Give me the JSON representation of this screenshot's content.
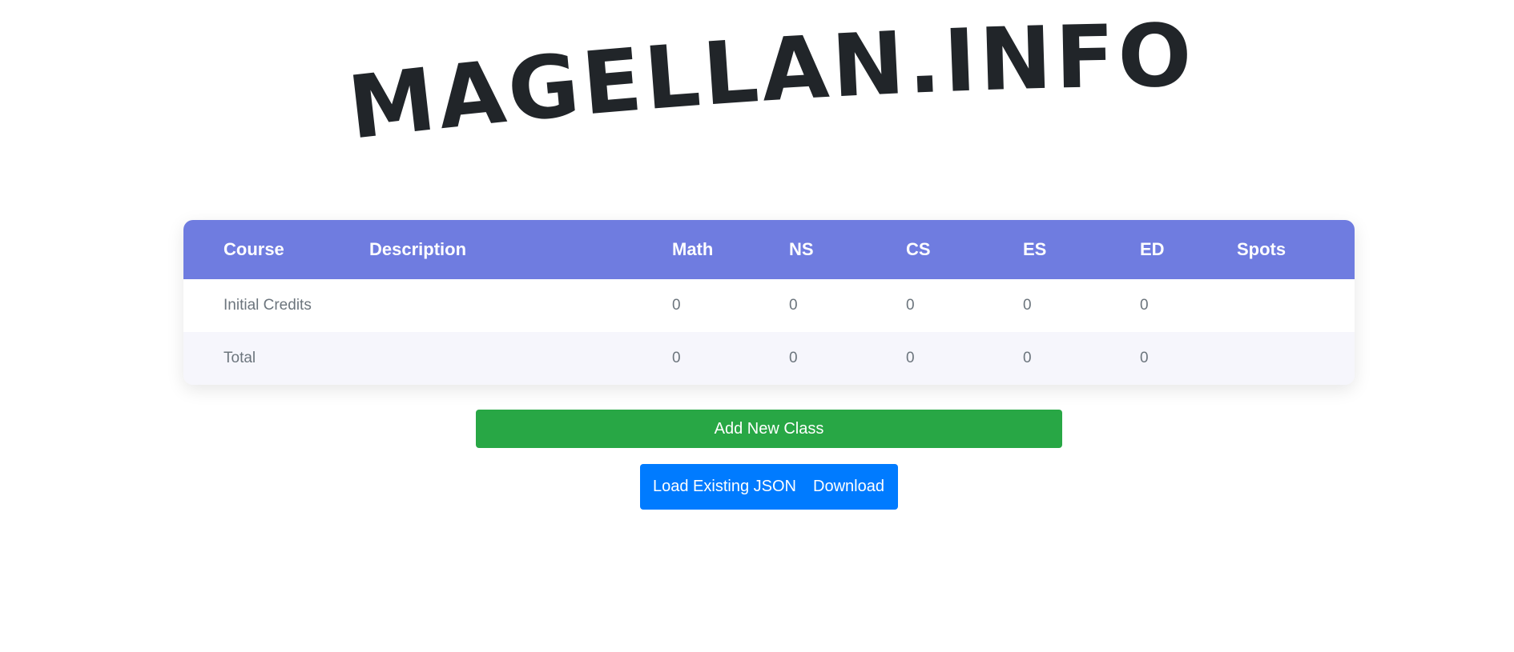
{
  "site": {
    "logo_text": "MAGELLAN.INFO"
  },
  "table": {
    "headers": [
      "Course",
      "Description",
      "Math",
      "NS",
      "CS",
      "ES",
      "ED",
      "Spots"
    ],
    "rows": [
      {
        "course": "Initial Credits",
        "description": "",
        "math": "0",
        "ns": "0",
        "cs": "0",
        "es": "0",
        "ed": "0",
        "spots": ""
      },
      {
        "course": "Total",
        "description": "",
        "math": "0",
        "ns": "0",
        "cs": "0",
        "es": "0",
        "ed": "0",
        "spots": ""
      }
    ]
  },
  "actions": {
    "add_class_label": "Add New Class",
    "load_json_label": "Load Existing JSON",
    "download_label": "Download"
  },
  "colors": {
    "header_bg": "#6f7ce0",
    "add_button": "#28a745",
    "group_button": "#007bff",
    "text_dark": "#212529",
    "text_muted": "#6c757d",
    "row_alt": "#f6f6fc"
  }
}
